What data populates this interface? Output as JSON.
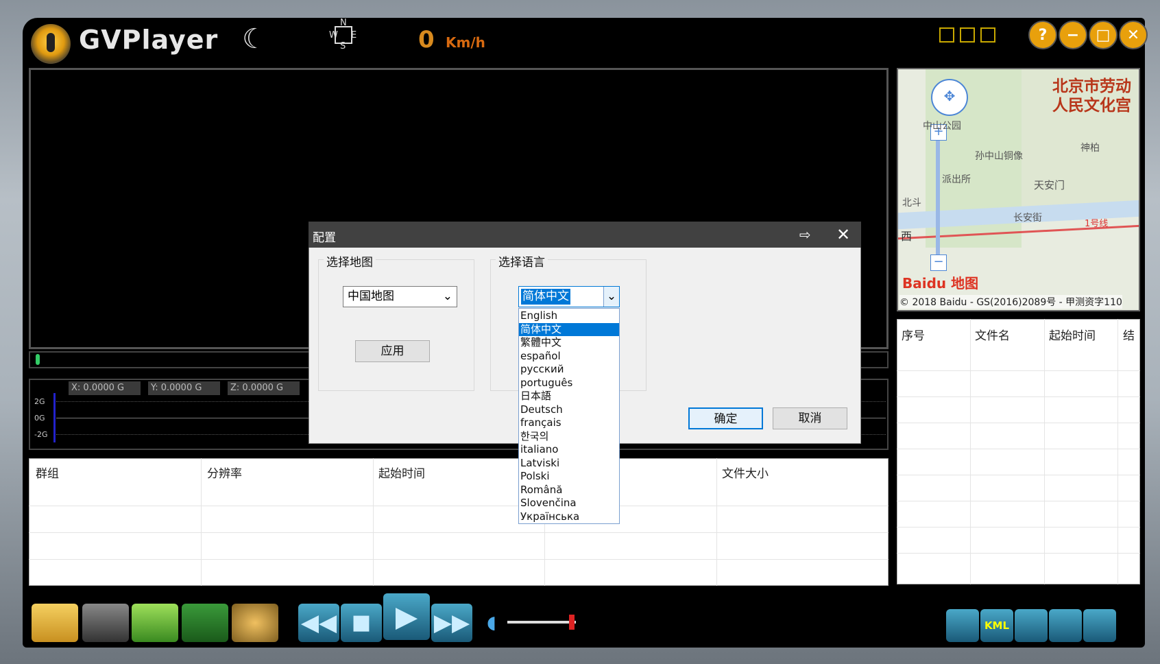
{
  "app": {
    "title": "GVPlayer",
    "speed_value": "0",
    "speed_unit": "Km/h",
    "compass_labels": [
      "N",
      "W",
      "E",
      "S"
    ]
  },
  "gsensor": {
    "x": "X: 0.0000 G",
    "y": "Y: 0.0000 G",
    "z": "Z: 0.0000 G",
    "scale": [
      "2G",
      "0G",
      "-2G"
    ]
  },
  "file_table": {
    "columns": [
      "群组",
      "分辨率",
      "起始时间",
      "",
      "文件大小"
    ]
  },
  "map": {
    "title": "北京市劳动\n人民文化宫",
    "labels": [
      "中山公园",
      "神柏",
      "孙中山铜像",
      "天安门",
      "派出所",
      "北斗",
      "长安街",
      "1号线",
      "西"
    ],
    "logo": "Baidu 地图",
    "copyright": "© 2018 Baidu - GS(2016)2089号 - 甲测资字110"
  },
  "right_list": {
    "columns": [
      "序号",
      "文件名",
      "起始时间",
      "结"
    ]
  },
  "dialog": {
    "title": "配置",
    "map_group_label": "选择地图",
    "map_select_value": "中国地图",
    "apply_label": "应用",
    "lang_group_label": "选择语言",
    "lang_select_value": "简体中文",
    "ok_label": "确定",
    "cancel_label": "取消",
    "languages": [
      "English",
      "简体中文",
      "繁體中文",
      "español",
      "русский",
      "português",
      "日本語",
      "Deutsch",
      "français",
      "한국의",
      "italiano",
      "Latviski",
      "Polski",
      "Română",
      "Slovenčina",
      "Українська"
    ],
    "selected_index": 1
  },
  "colors": {
    "accent": "#0078d7",
    "speed": "#d88a1e",
    "dialog_titlebar": "#414141"
  },
  "toolbar_icons": [
    "open-folder-icon",
    "camera-icon",
    "save-disk-icon",
    "recycle-bin-icon",
    "settings-wheel-icon",
    "rewind-icon",
    "stop-icon",
    "play-icon",
    "fast-forward-icon",
    "volume-icon",
    "repeat-icon",
    "kml-icon",
    "map-pin-icon",
    "chart-icon",
    "lock-icon"
  ],
  "toolbar_labels": {
    "kml": "KML"
  }
}
